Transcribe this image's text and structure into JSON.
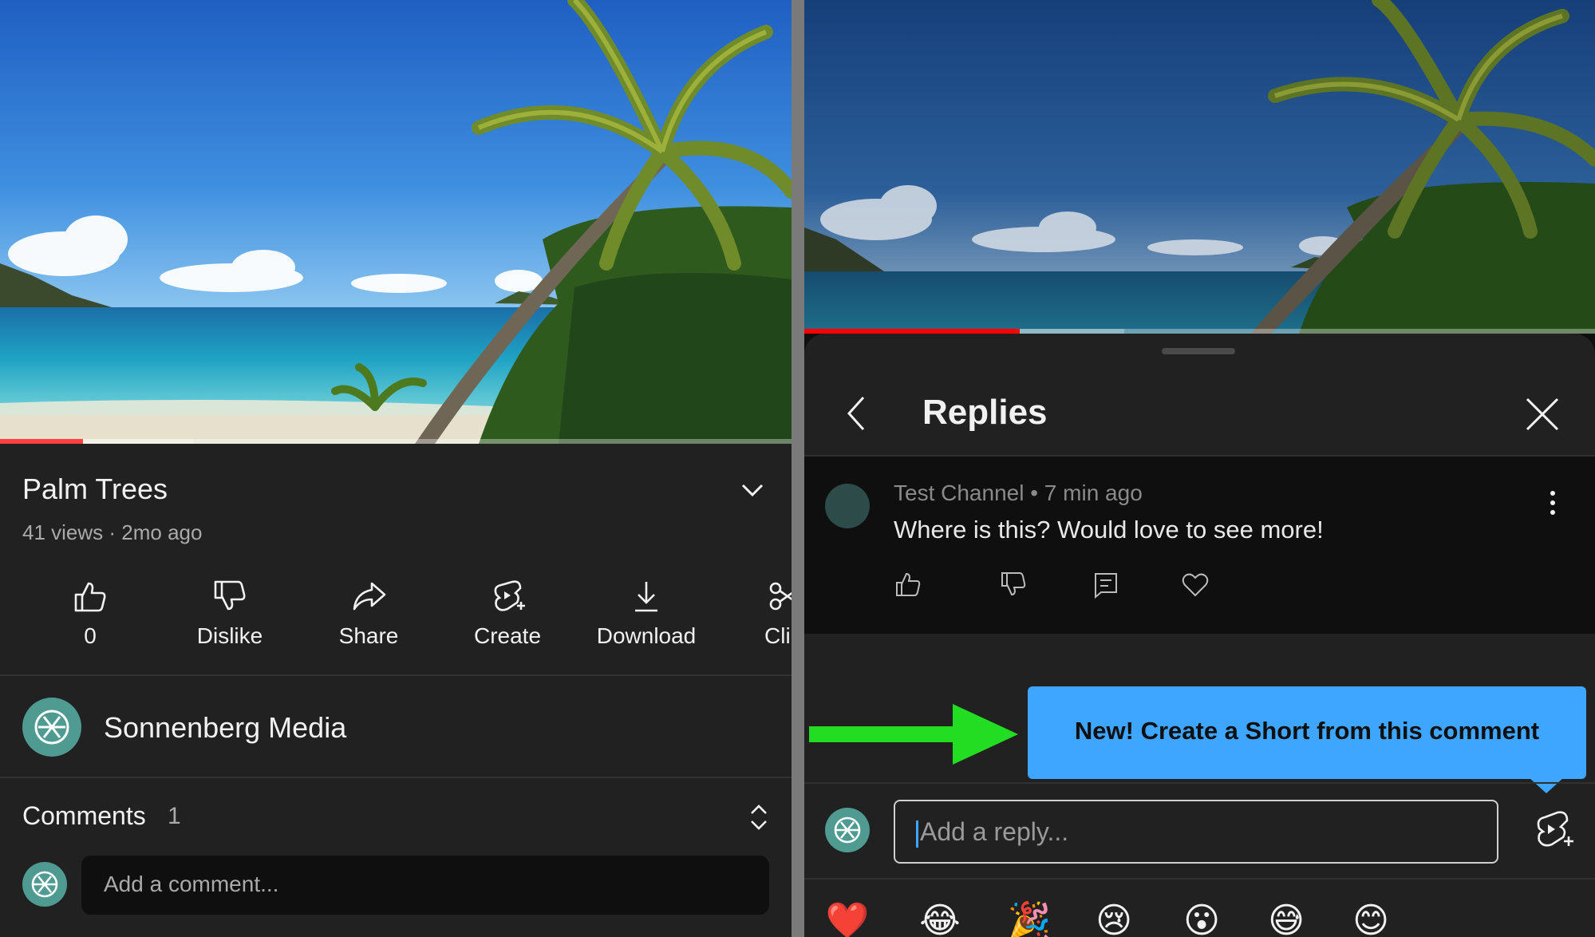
{
  "left": {
    "video": {
      "progress": 0.105,
      "buffered": 0.245
    },
    "title": "Palm Trees",
    "meta": "41 views · 2mo ago",
    "actions": [
      {
        "label": "0",
        "icon": "thumbs-up-icon"
      },
      {
        "label": "Dislike",
        "icon": "thumbs-down-icon"
      },
      {
        "label": "Share",
        "icon": "share-icon"
      },
      {
        "label": "Create",
        "icon": "create-shorts-icon"
      },
      {
        "label": "Download",
        "icon": "download-icon"
      },
      {
        "label": "Cli",
        "icon": "scissors-icon"
      }
    ],
    "channel": {
      "name": "Sonnenberg Media"
    },
    "comments": {
      "label": "Comments",
      "count": "1",
      "placeholder": "Add a comment..."
    }
  },
  "right": {
    "video": {
      "progress": 0.272,
      "buffered": 0.405
    },
    "sheet": {
      "title": "Replies",
      "comment": {
        "author_line": "Test Channel • 7 min ago",
        "text": "Where is this? Would love to see more!"
      },
      "tooltip": "New! Create a Short from this comment",
      "reply_placeholder": "Add a reply...",
      "emojis": [
        "❤️",
        "😂",
        "🎉",
        "😢",
        "😮",
        "😅",
        "😊"
      ]
    }
  },
  "colors": {
    "accent_blue": "#3ea6ff",
    "progress_red": "#ff0000",
    "arrow_green": "#22dd22",
    "avatar_teal": "#4f9a91"
  }
}
